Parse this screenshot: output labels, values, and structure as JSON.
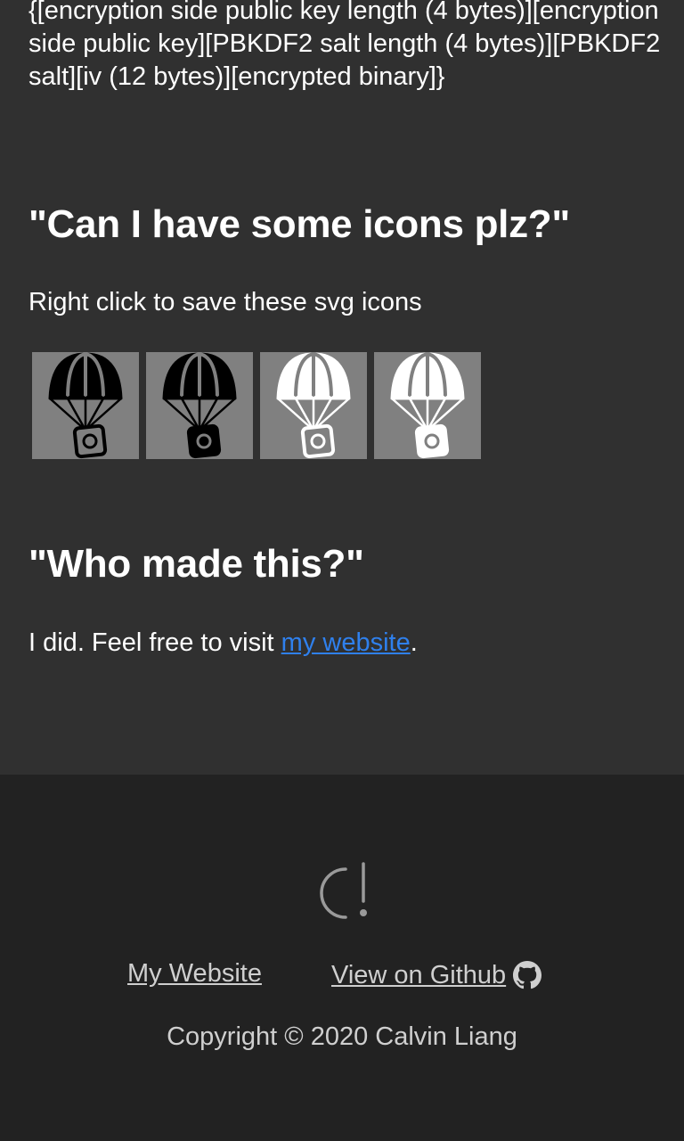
{
  "format": {
    "text": "{[encryption side public key length (4 bytes)][encryption side public key][PBKDF2 salt length (4 bytes)][PBKDF2 salt][iv (12 bytes)][encrypted binary]}"
  },
  "icons_section": {
    "heading": "\"Can I have some icons plz?\"",
    "description": "Right click to save these svg icons",
    "icons": [
      {
        "name": "parachute-outline-black",
        "style": "black-outline"
      },
      {
        "name": "parachute-filled-black",
        "style": "black-filled"
      },
      {
        "name": "parachute-outline-white",
        "style": "white-outline"
      },
      {
        "name": "parachute-filled-white",
        "style": "white-filled"
      }
    ]
  },
  "about_section": {
    "heading": "\"Who made this?\"",
    "text_before": "I did. Feel free to visit ",
    "link_label": "my website",
    "text_after": "."
  },
  "footer": {
    "logo_icon": "c-exclamation-logo",
    "my_website_label": "My Website",
    "github_label": "View on Github ",
    "github_icon": "github-icon",
    "copyright": "Copyright © 2020 Calvin Liang"
  },
  "colors": {
    "main_bg": "#303030",
    "footer_bg": "#222222",
    "link": "#2f80ed",
    "footer_text": "#cfcfcf",
    "tile_bg": "#808080"
  }
}
